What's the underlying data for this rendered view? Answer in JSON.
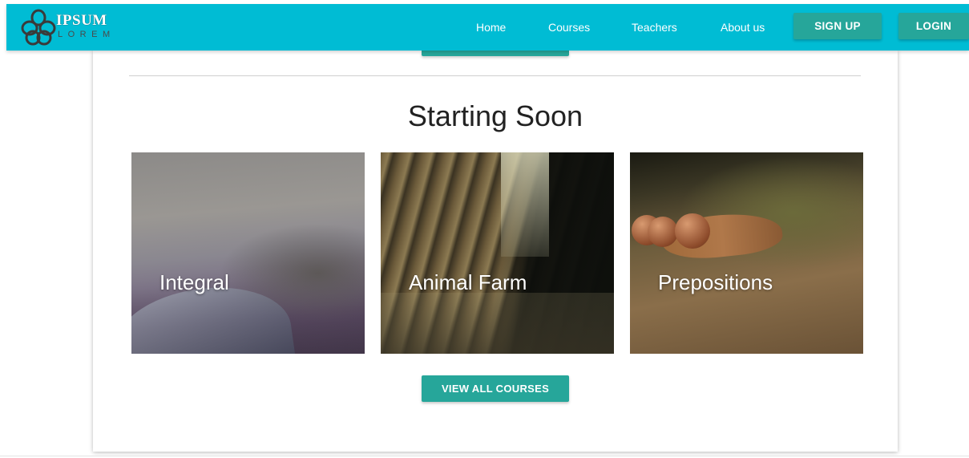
{
  "brand": {
    "name": "IPSUM",
    "subtitle": "LOREM"
  },
  "nav": {
    "links": [
      "Home",
      "Courses",
      "Teachers",
      "About us"
    ],
    "signup_label": "SIGN UP",
    "login_label": "LOGIN"
  },
  "section": {
    "title": "Starting Soon",
    "courses": [
      {
        "title": "Integral"
      },
      {
        "title": "Animal Farm"
      },
      {
        "title": "Prepositions"
      }
    ],
    "view_all_label": "VIEW ALL COURSES"
  },
  "colors": {
    "navbar": "#00bcd4",
    "button": "#26a69a",
    "text_dark": "#222222"
  }
}
